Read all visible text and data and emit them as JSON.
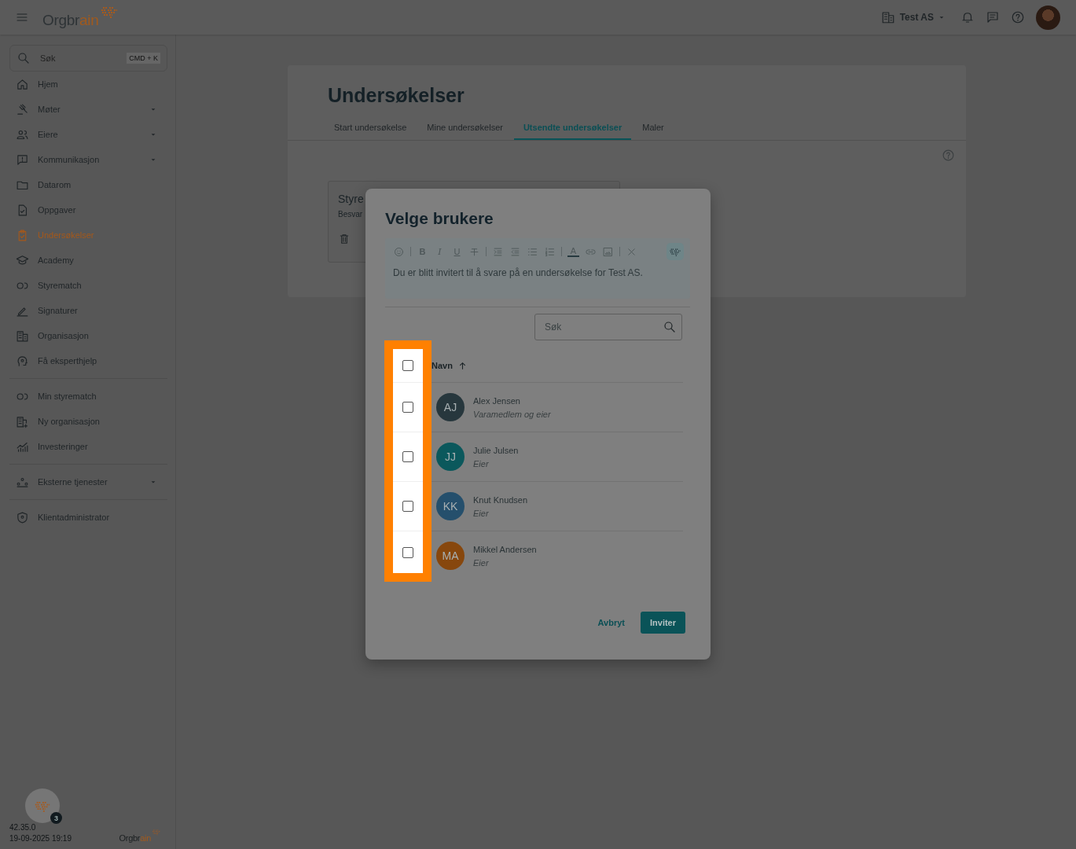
{
  "topbar": {
    "logo_parts": [
      "Orgbr",
      "ain"
    ],
    "organization": "Test AS"
  },
  "sidebar": {
    "search": {
      "placeholder": "Søk",
      "shortcut": "CMD + K"
    },
    "groups": [
      [
        {
          "label": "Hjem",
          "selected": false,
          "expandable": false
        },
        {
          "label": "Møter",
          "selected": false,
          "expandable": true
        },
        {
          "label": "Eiere",
          "selected": false,
          "expandable": true
        },
        {
          "label": "Kommunikasjon",
          "selected": false,
          "expandable": true
        },
        {
          "label": "Datarom",
          "selected": false,
          "expandable": false
        },
        {
          "label": "Oppgaver",
          "selected": false,
          "expandable": false
        },
        {
          "label": "Undersøkelser",
          "selected": true,
          "expandable": false
        },
        {
          "label": "Academy",
          "selected": false,
          "expandable": false
        },
        {
          "label": "Styrematch",
          "selected": false,
          "expandable": false
        },
        {
          "label": "Signaturer",
          "selected": false,
          "expandable": false
        },
        {
          "label": "Organisasjon",
          "selected": false,
          "expandable": false
        },
        {
          "label": "Få eksperthjelp",
          "selected": false,
          "expandable": false
        }
      ],
      [
        {
          "label": "Min styrematch",
          "selected": false,
          "expandable": false
        },
        {
          "label": "Ny organisasjon",
          "selected": false,
          "expandable": false
        },
        {
          "label": "Investeringer",
          "selected": false,
          "expandable": false
        }
      ],
      [
        {
          "label": "Eksterne tjenester",
          "selected": false,
          "expandable": true
        }
      ],
      [
        {
          "label": "Klientadministrator",
          "selected": false,
          "expandable": false
        }
      ]
    ],
    "footer": {
      "badge": "3",
      "version": "42.35.0",
      "timestamp": "19-09-2025 19:19",
      "logo_parts": [
        "Orgbr",
        "ain"
      ]
    }
  },
  "page": {
    "title": "Undersøkelser",
    "tabs": [
      {
        "label": "Start undersøkelse",
        "selected": false
      },
      {
        "label": "Mine undersøkelser",
        "selected": false
      },
      {
        "label": "Utsendte undersøkelser",
        "selected": true
      },
      {
        "label": "Maler",
        "selected": false
      }
    ],
    "survey_card": {
      "title": "Styre",
      "subtitle": "Besvar"
    }
  },
  "dialog": {
    "title": "Velge brukere",
    "editor": {
      "glyphs": [
        "B",
        "I",
        "U",
        "A"
      ],
      "text": "Du er blitt invitert til å svare på en undersøkelse for Test AS."
    },
    "search": {
      "placeholder": "Søk"
    },
    "select_all": {
      "checked": false
    },
    "column": "Navn",
    "users": [
      {
        "initials": "AJ",
        "name": "Alex Jensen",
        "role": "Varamedlem og eier",
        "color": "#27373d",
        "checked": false
      },
      {
        "initials": "JJ",
        "name": "Julie Julsen",
        "role": "Eier",
        "color": "#0b585c",
        "checked": false
      },
      {
        "initials": "KK",
        "name": "Knut Knudsen",
        "role": "Eier",
        "color": "#254f6c",
        "checked": false
      },
      {
        "initials": "MA",
        "name": "Mikkel Andersen",
        "role": "Eier",
        "color": "#87470d",
        "checked": false
      }
    ],
    "buttons": {
      "cancel": "Avbryt",
      "confirm": "Inviter"
    }
  }
}
